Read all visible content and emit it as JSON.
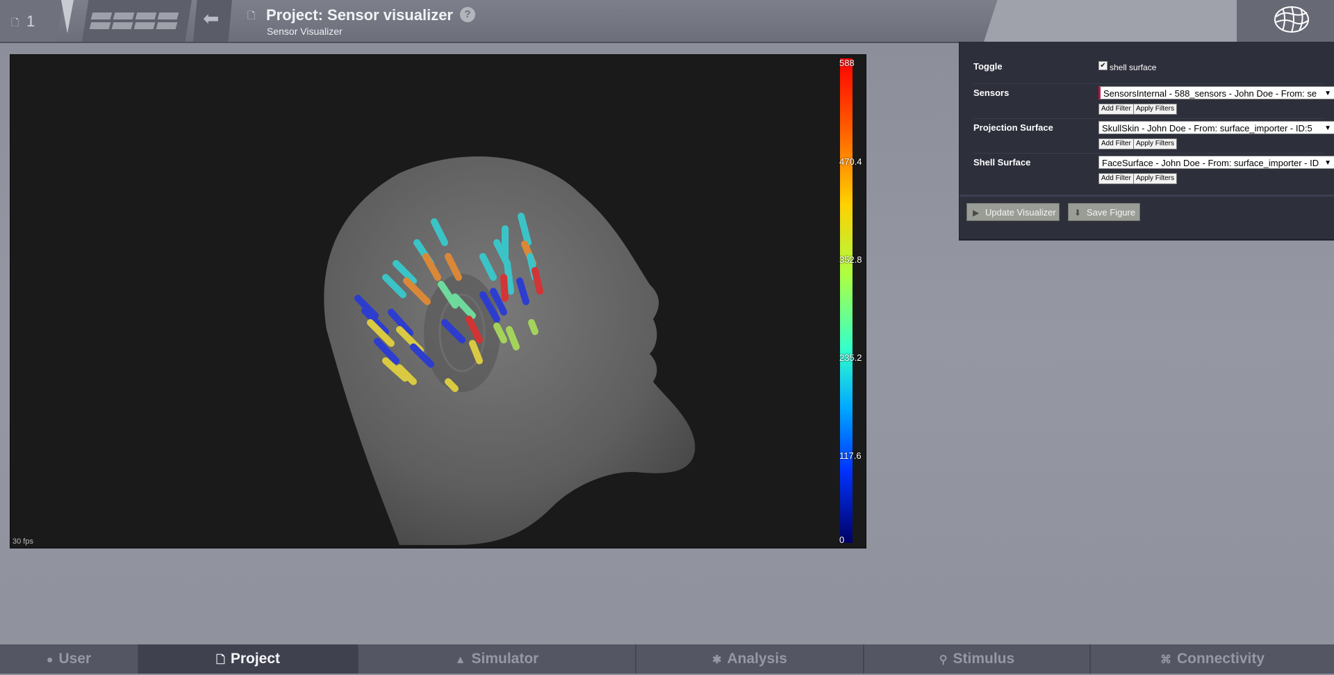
{
  "header": {
    "project_count": "1",
    "project_title": "Project: Sensor visualizer",
    "subtitle": "Sensor Visualizer",
    "help_label": "?"
  },
  "canvas": {
    "fps": "30 fps",
    "colorbar": {
      "ticks": [
        "588",
        "470.4",
        "352.8",
        "235.2",
        "117.6",
        "0"
      ]
    }
  },
  "panel": {
    "toggle": {
      "label": "Toggle",
      "checkbox_label": "shell surface",
      "checked": true
    },
    "sensors": {
      "label": "Sensors",
      "value": "SensorsInternal - 588_sensors - John Doe - From: se"
    },
    "projection": {
      "label": "Projection Surface",
      "value": "SkullSkin - John Doe - From: surface_importer - ID:5"
    },
    "shell": {
      "label": "Shell Surface",
      "value": "FaceSurface - John Doe - From: surface_importer - ID"
    },
    "add_filter": "Add Filter",
    "apply_filters": "Apply Filters",
    "update_button": "Update Visualizer",
    "save_button": "Save Figure"
  },
  "nav": {
    "tabs": [
      {
        "label": "User",
        "icon": "user-icon"
      },
      {
        "label": "Project",
        "icon": "document-icon",
        "active": true
      },
      {
        "label": "Simulator",
        "icon": "rocket-icon"
      },
      {
        "label": "Analysis",
        "icon": "gear-icon"
      },
      {
        "label": "Stimulus",
        "icon": "pin-icon"
      },
      {
        "label": "Connectivity",
        "icon": "network-icon"
      }
    ]
  }
}
